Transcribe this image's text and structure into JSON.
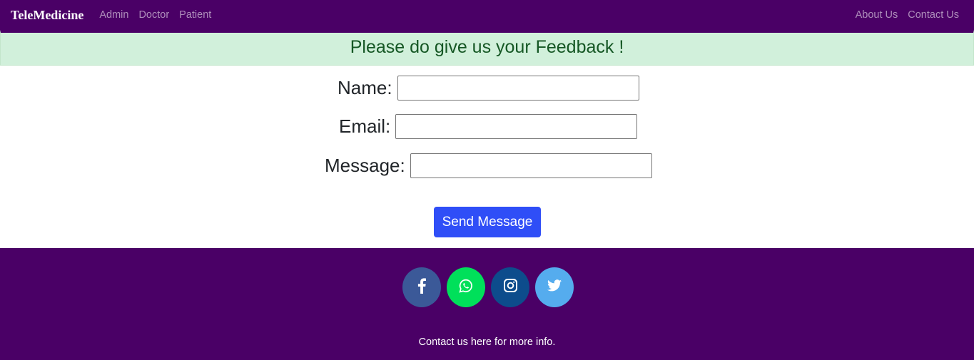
{
  "navbar": {
    "brand": "TeleMedicine",
    "left_links": [
      "Admin",
      "Doctor",
      "Patient"
    ],
    "right_links": [
      "About Us",
      "Contact Us"
    ]
  },
  "alert": {
    "text": "Please do give us your Feedback !"
  },
  "form": {
    "name_label": "Name:",
    "name_value": "",
    "email_label": "Email:",
    "email_value": "",
    "message_label": "Message:",
    "message_value": "",
    "submit_label": "Send Message"
  },
  "footer": {
    "social": [
      {
        "name": "facebook-icon",
        "color": "#3b5998"
      },
      {
        "name": "whatsapp-icon",
        "color": "#00e05a"
      },
      {
        "name": "instagram-icon",
        "color": "#0d4c8c"
      },
      {
        "name": "twitter-icon",
        "color": "#55acee"
      }
    ],
    "text": "Contact us here for more info."
  },
  "colors": {
    "brand_purple": "#4a0066",
    "alert_bg": "#d1f0db",
    "alert_text": "#155724",
    "button_blue": "#2f4ef7"
  }
}
